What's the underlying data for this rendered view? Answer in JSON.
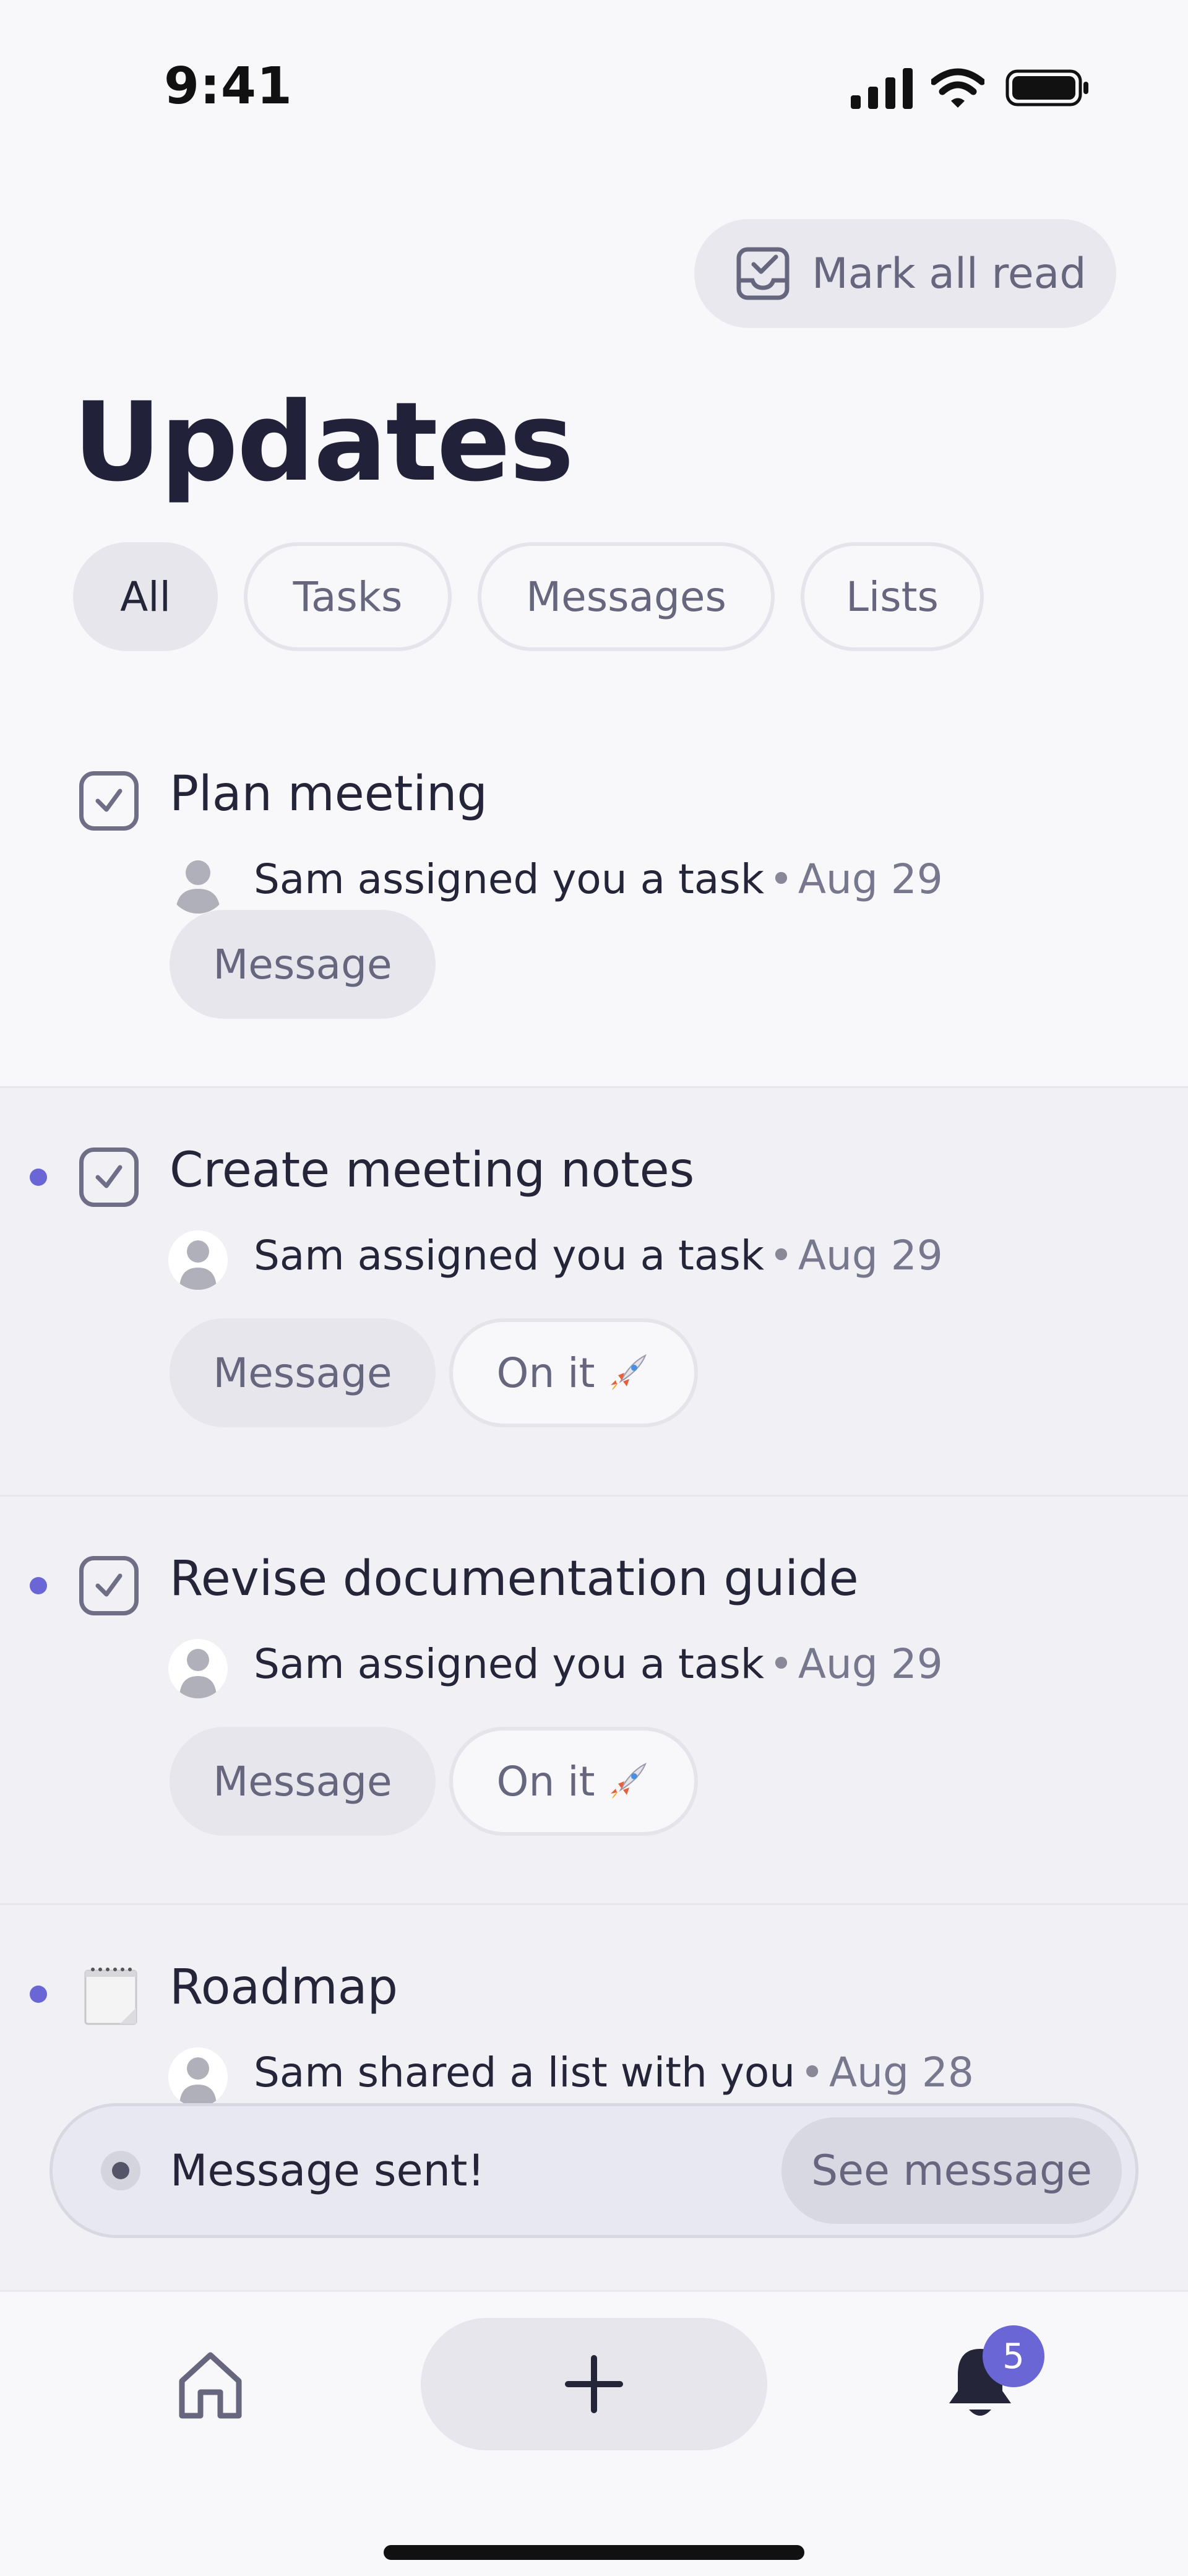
{
  "status_bar": {
    "time": "9:41"
  },
  "header": {
    "mark_all_read_label": "Mark all read",
    "title": "Updates"
  },
  "filters": [
    {
      "label": "All",
      "active": true
    },
    {
      "label": "Tasks",
      "active": false
    },
    {
      "label": "Messages",
      "active": false
    },
    {
      "label": "Lists",
      "active": false
    }
  ],
  "items": [
    {
      "title": "Plan meeting",
      "subtitle": "Sam assigned you a task",
      "date": "Aug 29",
      "unread": false,
      "icon": "task-checkbox-icon",
      "actions": {
        "message": "Message"
      }
    },
    {
      "title": "Create meeting notes",
      "subtitle": "Sam assigned you a task",
      "date": "Aug 29",
      "unread": true,
      "icon": "task-checkbox-icon",
      "actions": {
        "message": "Message",
        "on_it": "On it"
      }
    },
    {
      "title": "Revise documentation guide",
      "subtitle": "Sam assigned you a task",
      "date": "Aug 29",
      "unread": true,
      "icon": "task-checkbox-icon",
      "actions": {
        "message": "Message",
        "on_it": "On it"
      }
    },
    {
      "title": "Roadmap",
      "subtitle": "Sam shared a list with you",
      "date": "Aug 28",
      "unread": true,
      "icon": "notepad-icon"
    }
  ],
  "separator": "•",
  "toast": {
    "message": "Message sent!",
    "action": "See message"
  },
  "tab_bar": {
    "notification_count": "5"
  },
  "colors": {
    "accent": "#6a66d6",
    "background": "#f8f8fb",
    "unread_background": "#f0f0f5",
    "chip_background": "#e6e6ec",
    "text_primary": "#25253a",
    "text_secondary": "#66667e"
  }
}
